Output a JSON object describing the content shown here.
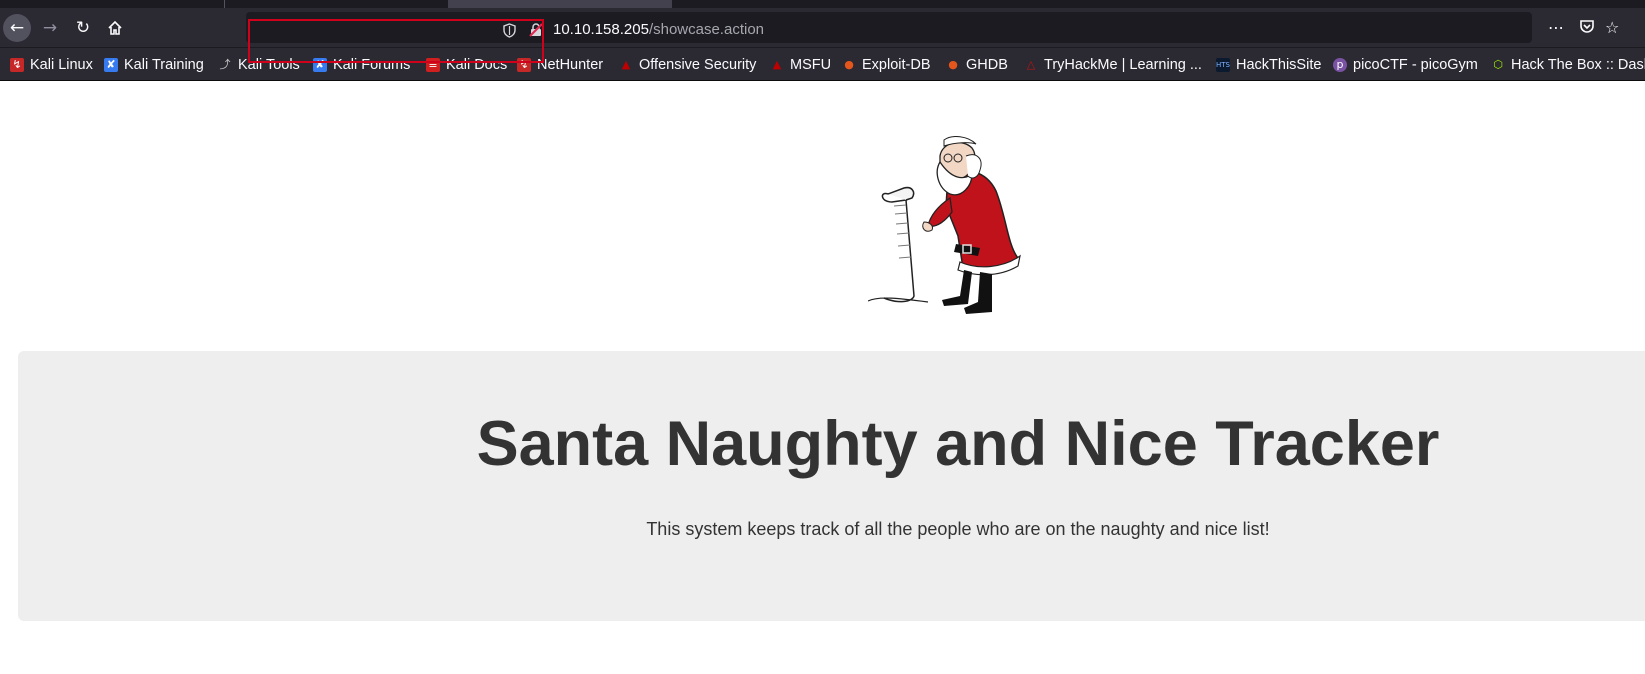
{
  "browser": {
    "url_host": "10.10.158.205",
    "url_path": "/showcase.action",
    "icons": [
      "back-arrow-icon",
      "forward-arrow-icon",
      "reload-icon",
      "home-icon",
      "shield-icon",
      "insecure-lock-icon",
      "more-icon",
      "pocket-icon",
      "bookmark-star-icon"
    ]
  },
  "bookmarks": [
    {
      "label": "Kali Linux",
      "icon": "kali-dragon-icon",
      "color": "#e8e8e8"
    },
    {
      "label": "Kali Training",
      "icon": "kali-training-icon",
      "color": "#367bf0"
    },
    {
      "label": "Kali Tools",
      "icon": "tools-icon",
      "color": "#cccccc"
    },
    {
      "label": "Kali Forums",
      "icon": "kali-forums-icon",
      "color": "#367bf0"
    },
    {
      "label": "Kali Docs",
      "icon": "docs-icon",
      "color": "#d11f1f"
    },
    {
      "label": "NetHunter",
      "icon": "nethunter-icon",
      "color": "#e8e8e8"
    },
    {
      "label": "Offensive Security",
      "icon": "offsec-icon",
      "color": "#c00000"
    },
    {
      "label": "MSFU",
      "icon": "msfu-icon",
      "color": "#c00000"
    },
    {
      "label": "Exploit-DB",
      "icon": "exploit-db-icon",
      "color": "#e5561c"
    },
    {
      "label": "GHDB",
      "icon": "ghdb-icon",
      "color": "#e5561c"
    },
    {
      "label": "TryHackMe | Learning ...",
      "icon": "tryhackme-icon",
      "color": "#c11111"
    },
    {
      "label": "HackThisSite",
      "icon": "hackthissite-icon",
      "color": "#2a4d7a"
    },
    {
      "label": "picoCTF - picoGym",
      "icon": "picoctf-icon",
      "color": "#7a52a3"
    },
    {
      "label": "Hack The Box :: Dashboard",
      "icon": "hackthebox-icon",
      "color": "#9fef00"
    }
  ],
  "page": {
    "title": "Santa Naughty and Nice Tracker",
    "subtitle": "This system keeps track of all the people who are on the naughty and nice list!"
  },
  "colors": {
    "highlight": "#d0021b",
    "jumbotron_bg": "#eeeeee",
    "text": "#333333",
    "santa_red": "#c0121a"
  }
}
